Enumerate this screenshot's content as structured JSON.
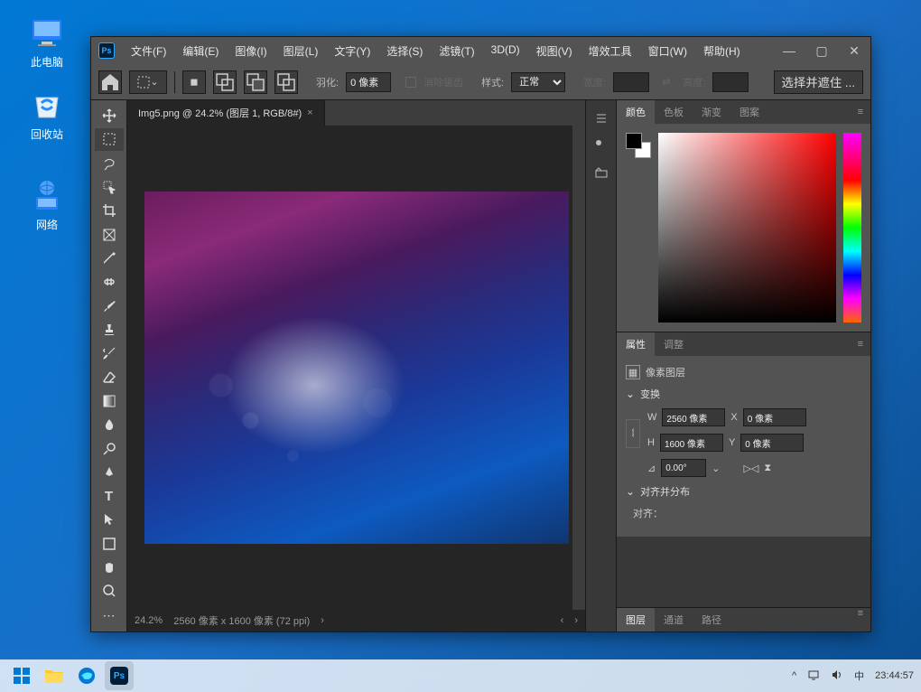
{
  "desktop": {
    "icons": [
      {
        "label": "此电脑"
      },
      {
        "label": "回收站"
      },
      {
        "label": "网络"
      }
    ]
  },
  "menus": {
    "file": "文件(F)",
    "edit": "编辑(E)",
    "image": "图像(I)",
    "layer": "图层(L)",
    "type": "文字(Y)",
    "select": "选择(S)",
    "filter": "滤镜(T)",
    "threeD": "3D(D)",
    "view": "视图(V)",
    "plugins": "增效工具",
    "window": "窗口(W)",
    "help": "帮助(H)"
  },
  "options": {
    "feather_label": "羽化:",
    "feather_value": "0 像素",
    "antialias": "消除锯齿",
    "style_label": "样式:",
    "style_value": "正常",
    "width_label": "宽度:",
    "height_label": "高度:",
    "select_mask": "选择并遮住 ..."
  },
  "document": {
    "tab_title": "Img5.png @ 24.2% (图层 1, RGB/8#)",
    "zoom": "24.2%",
    "dimensions": "2560 像素 x 1600 像素 (72 ppi)"
  },
  "panels": {
    "color": "颜色",
    "swatches": "色板",
    "gradients": "渐变",
    "patterns": "图案",
    "properties": "属性",
    "adjustments": "调整",
    "layers": "图层",
    "channels": "通道",
    "paths": "路径"
  },
  "properties": {
    "layer_type": "像素图层",
    "transform_header": "变换",
    "align_header": "对齐并分布",
    "align_label": "对齐：",
    "w_label": "W",
    "w_value": "2560 像素",
    "h_label": "H",
    "h_value": "1600 像素",
    "x_label": "X",
    "x_value": "0 像素",
    "y_label": "Y",
    "y_value": "0 像素",
    "angle_value": "0.00°"
  },
  "taskbar": {
    "ime": "中",
    "time": "23:44:57"
  }
}
